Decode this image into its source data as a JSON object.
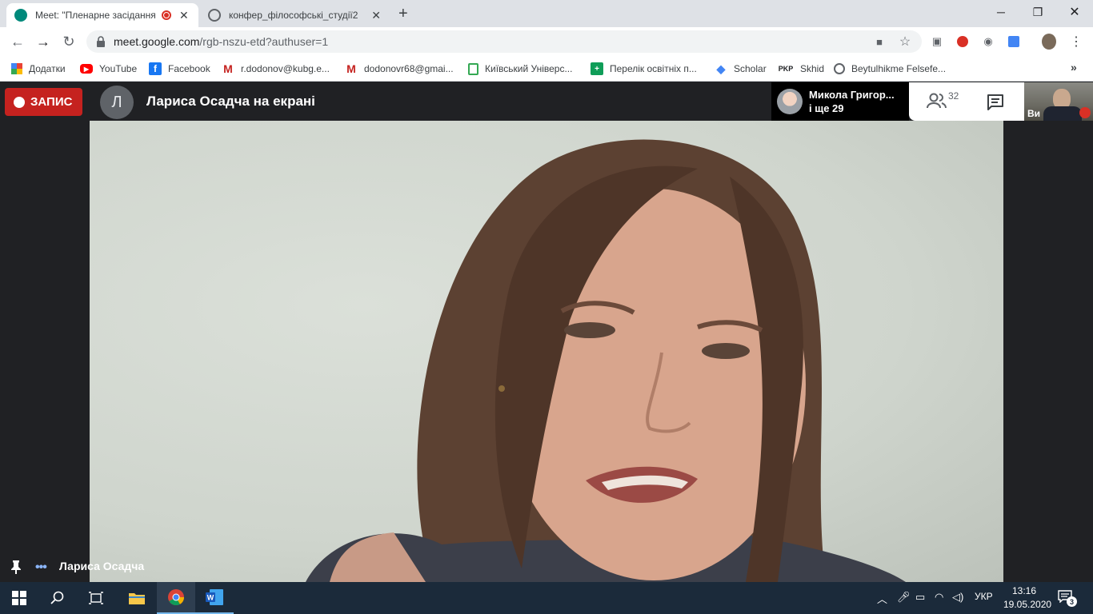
{
  "browser": {
    "tabs": [
      {
        "title": "Meet: \"Пленарне засідання",
        "active": true,
        "recording": true
      },
      {
        "title": "конфер_філософські_студії2",
        "active": false
      }
    ],
    "address": {
      "host": "meet.google.com",
      "path": "/rgb-nszu-etd?authuser=1"
    },
    "bookmarks": [
      {
        "label": "Додатки",
        "icon": "apps-grid-icon"
      },
      {
        "label": "YouTube",
        "icon": "youtube-icon"
      },
      {
        "label": "Facebook",
        "icon": "facebook-icon"
      },
      {
        "label": "r.dodonov@kubg.e...",
        "icon": "gmail-icon"
      },
      {
        "label": "dodonovr68@gmai...",
        "icon": "gmail-icon"
      },
      {
        "label": "Київський Універс...",
        "icon": "university-icon"
      },
      {
        "label": "Перелік освітніх п...",
        "icon": "plus-doc-icon"
      },
      {
        "label": "Scholar",
        "icon": "scholar-icon"
      },
      {
        "label": "Skhid",
        "icon": "pkp-icon"
      },
      {
        "label": "Beytulhikme Felsefe...",
        "icon": "globe-icon"
      }
    ],
    "bookmark_pkp_text": "PKP"
  },
  "meet": {
    "recording_label": "ЗАПИС",
    "presenter_initial": "Л",
    "presenter_title": "Лариса Осадча на екрані",
    "participant_name": "Микола Григор...",
    "participant_more": "і ще 29",
    "people_count": "32",
    "self_label": "Ви",
    "speaker_name": "Лариса Осадча"
  },
  "taskbar": {
    "language": "УКР",
    "time": "13:16",
    "date": "19.05.2020",
    "notifications": "3"
  },
  "colors": {
    "record_red": "#c5221f",
    "meet_bg": "#202124",
    "taskbar_bg": "#1b2a3a"
  }
}
